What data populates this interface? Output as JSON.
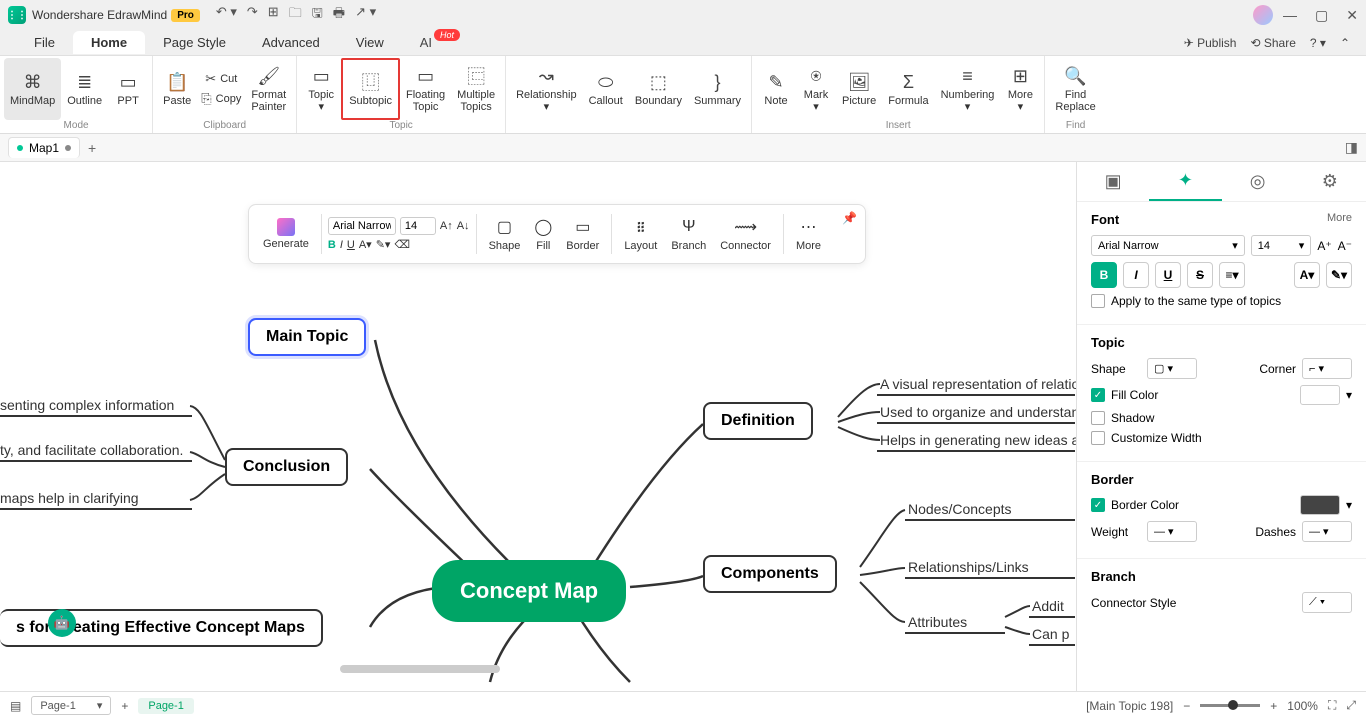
{
  "titlebar": {
    "app": "Wondershare EdrawMind",
    "pro": "Pro"
  },
  "menu": {
    "file": "File",
    "home": "Home",
    "pagestyle": "Page Style",
    "advanced": "Advanced",
    "view": "View",
    "ai": "AI",
    "hot": "Hot",
    "publish": "Publish",
    "share": "Share"
  },
  "ribbon": {
    "mode": {
      "mindmap": "MindMap",
      "outline": "Outline",
      "ppt": "PPT",
      "label": "Mode"
    },
    "clipboard": {
      "paste": "Paste",
      "cut": "Cut",
      "copy": "Copy",
      "formatpainter": "Format\nPainter",
      "label": "Clipboard"
    },
    "topic": {
      "topic": "Topic",
      "subtopic": "Subtopic",
      "floating": "Floating\nTopic",
      "multiple": "Multiple\nTopics",
      "label": "Topic"
    },
    "insert": {
      "relationship": "Relationship",
      "callout": "Callout",
      "boundary": "Boundary",
      "summary": "Summary",
      "note": "Note",
      "mark": "Mark",
      "picture": "Picture",
      "formula": "Formula",
      "numbering": "Numbering",
      "more": "More",
      "label": "Insert"
    },
    "find": {
      "findreplace": "Find\nReplace",
      "label": "Find"
    }
  },
  "doctab": {
    "name": "Map1"
  },
  "floatbar": {
    "generate": "Generate",
    "font": "Arial Narrow",
    "size": "14",
    "shape": "Shape",
    "fill": "Fill",
    "border": "Border",
    "layout": "Layout",
    "branch": "Branch",
    "connector": "Connector",
    "more": "More"
  },
  "nodes": {
    "center": "Concept Map",
    "maintopic": "Main Topic",
    "conclusion": "Conclusion",
    "definition": "Definition",
    "components": "Components",
    "tips": "s for Creating Effective Concept Maps",
    "def1": "A visual representation of relatio",
    "def2": "Used to organize and understan",
    "def3": "Helps in generating new ideas a",
    "comp1": "Nodes/Concepts",
    "comp2": "Relationships/Links",
    "comp3": "Attributes",
    "comp3a": "Addit",
    "comp3b": "Can p",
    "conc1": "senting complex information",
    "conc2": "ty, and facilitate collaboration.",
    "conc3": "maps help in clarifying"
  },
  "sidepanel": {
    "font": {
      "head": "Font",
      "more": "More",
      "family": "Arial Narrow",
      "size": "14",
      "apply": "Apply to the same type of topics"
    },
    "topic": {
      "head": "Topic",
      "shape": "Shape",
      "corner": "Corner",
      "fill": "Fill Color",
      "shadow": "Shadow",
      "customwidth": "Customize Width"
    },
    "border": {
      "head": "Border",
      "color": "Border Color",
      "weight": "Weight",
      "dashes": "Dashes"
    },
    "branch": {
      "head": "Branch",
      "connector": "Connector Style"
    }
  },
  "status": {
    "page": "Page-1",
    "pagelabel": "Page-1",
    "selinfo": "[Main Topic 198]",
    "zoom": "100%"
  }
}
